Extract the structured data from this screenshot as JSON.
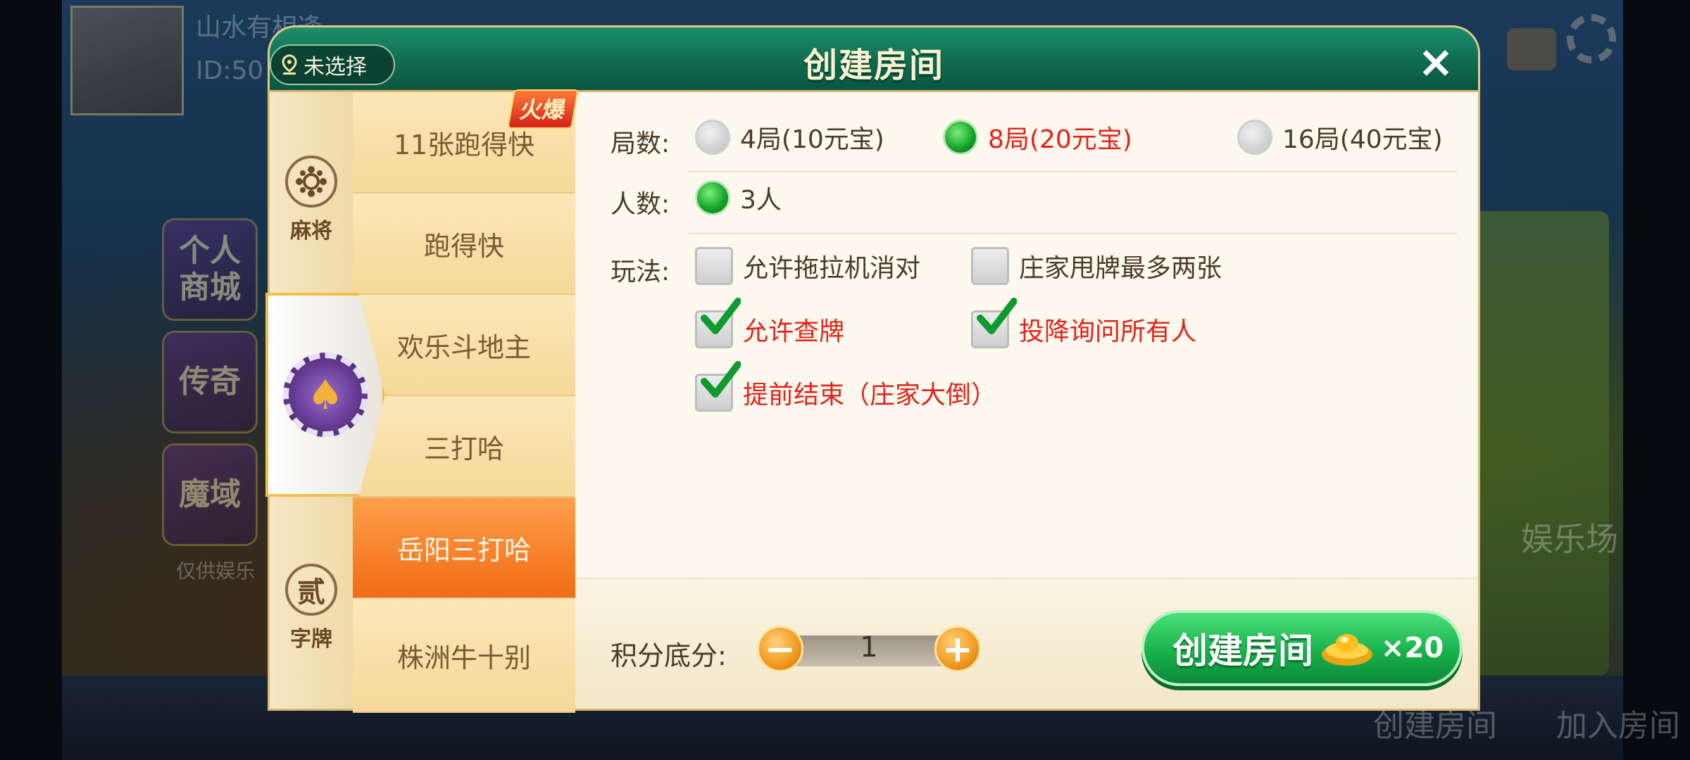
{
  "background": {
    "player_name": "山水有相逢",
    "player_id": "ID:50",
    "tiles": [
      "个人商城",
      "传奇",
      "魔域"
    ],
    "tile_caption": "仅供娱乐",
    "bottom_labels": [
      "创建房间",
      "加入房间"
    ],
    "venue_label": "娱乐场"
  },
  "dialog": {
    "title": "创建房间",
    "location_label": "未选择",
    "close_symbol": "×"
  },
  "categories": [
    {
      "label": "麻将",
      "icon": "mahjong-icon"
    },
    {
      "label": "",
      "icon": "spade-chip-icon",
      "active": true
    },
    {
      "label": "字牌",
      "icon": "zipai-icon",
      "glyph": "贰"
    }
  ],
  "games": [
    {
      "label": "11张跑得快",
      "hot": "火爆"
    },
    {
      "label": "跑得快"
    },
    {
      "label": "欢乐斗地主"
    },
    {
      "label": "三打哈"
    },
    {
      "label": "岳阳三打哈",
      "selected": true
    },
    {
      "label": "株洲牛十别"
    }
  ],
  "settings": {
    "rounds_label": "局数:",
    "rounds_options": [
      {
        "label": "4局(10元宝)",
        "selected": false
      },
      {
        "label": "8局(20元宝)",
        "selected": true
      },
      {
        "label": "16局(40元宝)",
        "selected": false
      }
    ],
    "players_label": "人数:",
    "players_options": [
      {
        "label": "3人",
        "selected": true
      }
    ],
    "rules_label": "玩法:",
    "rules_options": [
      {
        "label": "允许拖拉机消对",
        "checked": false
      },
      {
        "label": "庄家甩牌最多两张",
        "checked": false
      },
      {
        "label": "允许查牌",
        "checked": true
      },
      {
        "label": "投降询问所有人",
        "checked": true
      },
      {
        "label": "提前结束（庄家大倒）",
        "checked": true
      }
    ]
  },
  "bottom": {
    "score_label": "积分底分:",
    "score_value": "1",
    "minus": "−",
    "plus": "+",
    "create_label": "创建房间",
    "create_cost": "×20"
  },
  "colors": {
    "accent_red": "#e3231b",
    "title_green": "#0f6b4f",
    "selected_orange": "#f26b16",
    "create_green": "#17b24c"
  }
}
